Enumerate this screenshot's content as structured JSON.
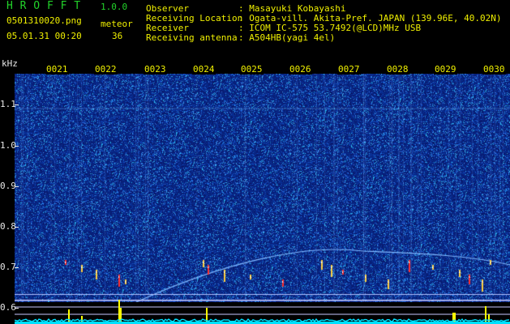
{
  "header": {
    "app_title": "H R O F F T",
    "version": "1.0.0",
    "filename": "0501310020.png",
    "meteor_label": "meteor",
    "meteor_count": "36",
    "datetime": "05.01.31 00:20"
  },
  "meta": [
    {
      "key": "Observer",
      "value": ": Masayuki Kobayashi"
    },
    {
      "key": "Receiving Location",
      "value": ": Ogata-vill. Akita-Pref. JAPAN (139.96E, 40.02N)"
    },
    {
      "key": "Receiver",
      "value": ": ICOM IC-575 53.7492(@LCD)MHz USB"
    },
    {
      "key": "Receiving antenna",
      "value": ": A504HB(yagi 4el)"
    }
  ],
  "axis": {
    "unit": "kHz",
    "freq_labels": [
      "1.1",
      "1.0",
      "0.9",
      "0.8",
      "0.7",
      "0.6"
    ],
    "minute_labels": [
      "0021",
      "0022",
      "0023",
      "0024",
      "0025",
      "0026",
      "0027",
      "0028",
      "0029",
      "0030"
    ]
  },
  "colors": {
    "background": "#000000",
    "header_green": "#22d32a",
    "header_yellow": "#f0f000",
    "spectrum_base": "#0a1a7a",
    "spectrum_noise": "#2a60d8",
    "carrier_line": "#7fb8ff",
    "meteor_echo": "#ff3030",
    "bottom_bars": "#ffff00",
    "bottom_floor": "#00e0ff"
  }
}
